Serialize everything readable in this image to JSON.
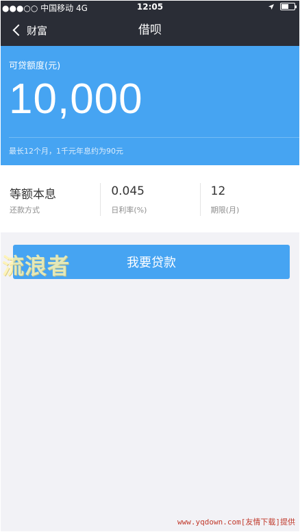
{
  "status_bar": {
    "carrier": "●●●○○ 中国移动  4G",
    "time": "12:05",
    "battery_level": 0.55
  },
  "nav": {
    "back_label": "财富",
    "title": "借呗"
  },
  "loan_card": {
    "label": "可贷额度(元)",
    "amount": "10,000",
    "note": "最长12个月，1千元年息约为90元"
  },
  "terms": [
    {
      "value": "等额本息",
      "caption": "还款方式"
    },
    {
      "value": "0.045",
      "caption": "日利率(%)"
    },
    {
      "value": "12",
      "caption": "期限(月)"
    }
  ],
  "apply_button": {
    "label": "我要贷款"
  },
  "watermark": {
    "text": "流浪者"
  },
  "footer": {
    "credit": "www.yqdown.com[友情下载]提供"
  },
  "colors": {
    "accent": "#46a4f2",
    "nav_bg": "#2a2d36"
  }
}
